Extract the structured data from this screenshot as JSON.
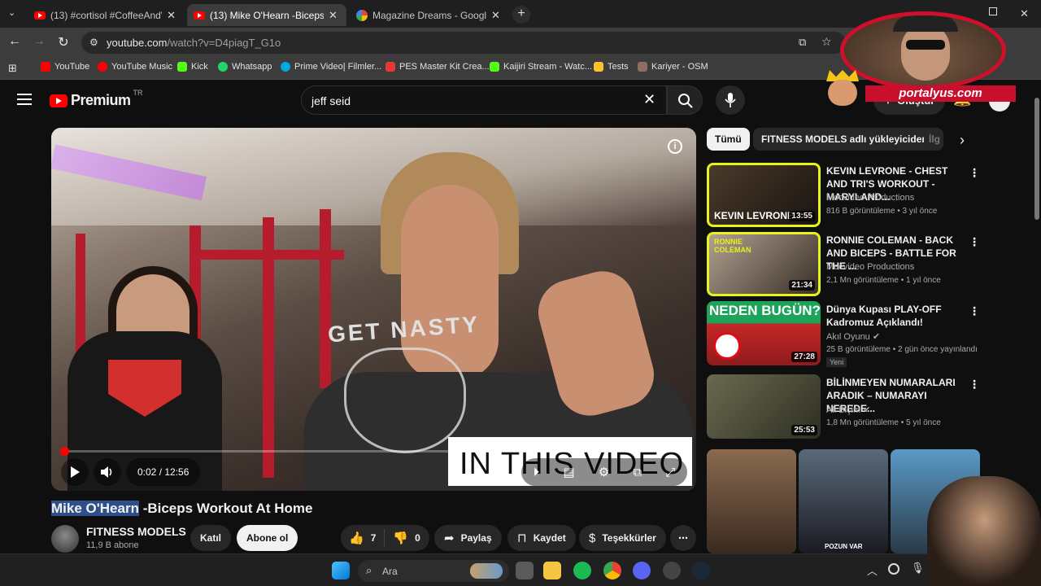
{
  "browser": {
    "tabs": [
      {
        "label": "(13) #cortisol #CoffeeAndWorkout",
        "active": false
      },
      {
        "label": "(13) Mike O'Hearn -Biceps Workout",
        "active": true
      },
      {
        "label": "Magazine Dreams - Google'da Ara",
        "active": false
      }
    ],
    "url": "youtube.com/watch?v=D4piagT_G1o",
    "url_host": "youtube.com",
    "url_path": "/watch?v=D4piagT_G1o",
    "bookmarks": [
      {
        "label": "YouTube",
        "color": "#ff0000"
      },
      {
        "label": "YouTube Music",
        "color": "#ff0000"
      },
      {
        "label": "Kick",
        "color": "#53fc18"
      },
      {
        "label": "Whatsapp",
        "color": "#25d366"
      },
      {
        "label": "Prime Video| Filmler...",
        "color": "#00a8e1"
      },
      {
        "label": "PES Master Kit Crea...",
        "color": "#e53935"
      },
      {
        "label": "Kaijiri Stream - Watc...",
        "color": "#53fc18"
      },
      {
        "label": "Tests",
        "color": "#fbc02d"
      },
      {
        "label": "Kariyer - OSM",
        "color": "#8d6e63"
      }
    ]
  },
  "youtube": {
    "logo": "Premium",
    "region": "TR",
    "search_query": "jeff seid",
    "create_label": "Oluştur"
  },
  "video": {
    "title_highlight": "Mike O'Hearn",
    "title_rest": " -Biceps Workout At Home",
    "time": "0:02 / 12:56",
    "progress": 0.003,
    "overlay_text": "IN THIS VIDEO",
    "shirt_text": "GET NASTY",
    "channel": "FITNESS MODELS",
    "subscribers": "11,9 B abone",
    "join_label": "Katıl",
    "subscribe_label": "Abone ol",
    "likes": "7",
    "dislikes": "0",
    "share_label": "Paylaş",
    "save_label": "Kaydet",
    "thanks_label": "Teşekkürler"
  },
  "sidebar": {
    "chips": [
      "Tümü",
      "FITNESS MODELS adlı yükleyiciden",
      "İlg"
    ],
    "videos": [
      {
        "title": "KEVIN LEVRONE - CHEST AND TRI'S WORKOUT - MARYLAND...",
        "channel": "Mocvideo Productions",
        "meta": "816 B görüntüleme • 3 yıl önce",
        "duration": "13:55",
        "thumb_text": "KEVIN LEVRONE",
        "new": ""
      },
      {
        "title": "RONNIE COLEMAN - BACK AND BICEPS - BATTLE FOR THE ...",
        "channel": "Mocvideo Productions",
        "meta": "2,1 Mn görüntüleme • 1 yıl önce",
        "duration": "21:34",
        "thumb_text": "RONNIE COLEMAN",
        "new": ""
      },
      {
        "title": "Dünya Kupası PLAY-OFF Kadromuz Açıklandı!",
        "channel": "Akıl Oyunu",
        "meta": "25 B görüntüleme • 2 gün önce yayınlandı",
        "duration": "27:28",
        "thumb_text": "NEDEN BUGÜN?",
        "new": "Yeni"
      },
      {
        "title": "BİLİNMEYEN NUMARALARI ARADIK – NUMARAYI NEREDE...",
        "channel": "Ali Biçim",
        "meta": "1,8 Mn görüntüleme • 5 yıl önce",
        "duration": "25:53",
        "thumb_text": "",
        "new": ""
      }
    ],
    "shorts_caption": "POZUN VAR"
  },
  "taskbar": {
    "search_label": "Ara"
  },
  "watermark": {
    "brand": "portalyus.com"
  }
}
